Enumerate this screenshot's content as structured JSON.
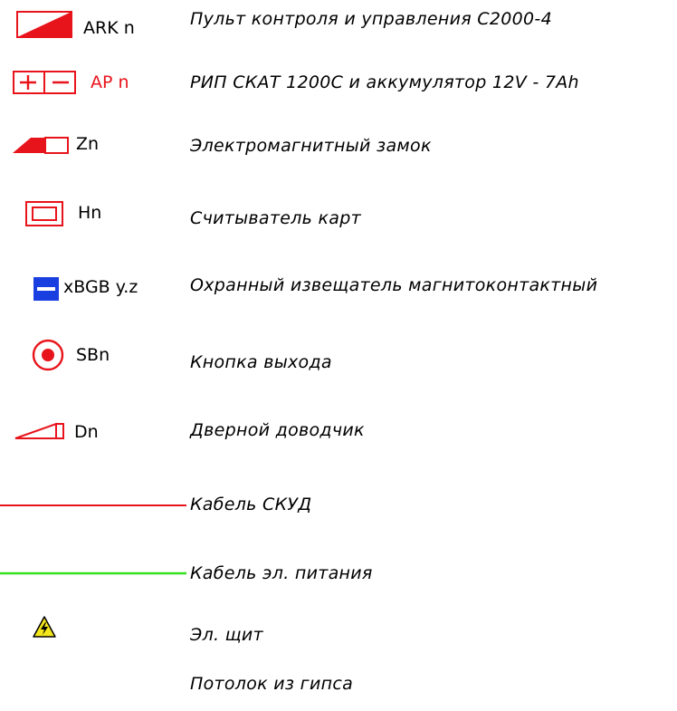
{
  "legend": {
    "items": [
      {
        "code": "ARK n",
        "code_color": "#000000",
        "description": "Пульт контроля и управления С2000-4"
      },
      {
        "code": "AP n",
        "code_color": "#e8141b",
        "description": "РИП СКАТ 1200С и аккумулятор 12V - 7Ah"
      },
      {
        "code": "Zn",
        "code_color": "#000000",
        "description": "Электромагнитный замок"
      },
      {
        "code": "Hn",
        "code_color": "#000000",
        "description": "Считыватель карт"
      },
      {
        "code": "xBGB y.z",
        "code_color": "#000000",
        "description": "Охранный извещатель магнитоконтактный"
      },
      {
        "code": "SBn",
        "code_color": "#000000",
        "description": "Кнопка выхода"
      },
      {
        "code": "Dn",
        "code_color": "#000000",
        "description": "Дверной доводчик"
      },
      {
        "code": "",
        "code_color": "#000000",
        "description": "Кабель СКУД"
      },
      {
        "code": "",
        "code_color": "#000000",
        "description": "Кабель эл. питания"
      },
      {
        "code": "",
        "code_color": "#000000",
        "description": "Эл. щит"
      },
      {
        "code": "",
        "code_color": "#000000",
        "description": "Потолок из гипса"
      }
    ]
  },
  "colors": {
    "red": "#e8141b",
    "green": "#36e01f",
    "blue": "#1a3fe0",
    "yellow": "#f3e61a",
    "black": "#000000"
  },
  "icons": {
    "ark": "control-panel-icon",
    "ap": "power-supply-icon",
    "zn": "electromagnetic-lock-icon",
    "hn": "card-reader-icon",
    "bgb": "magnetic-contact-detector-icon",
    "sbn": "exit-button-icon",
    "dn": "door-closer-icon",
    "cable_skud": "skud-cable-line-icon",
    "cable_power": "power-cable-line-icon",
    "panel": "electrical-panel-icon"
  }
}
